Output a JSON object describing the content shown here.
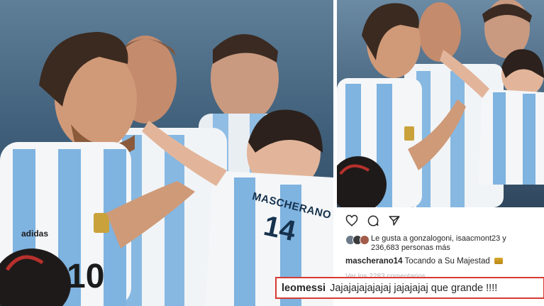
{
  "post": {
    "actions": {
      "like_icon": "heart-outline-icon",
      "comment_icon": "comment-bubble-icon",
      "share_icon": "paper-plane-icon"
    },
    "likes_line_1": "Le gusta a gonzalogoni, isaacmont23 y",
    "likes_line_2": "236,683 personas más",
    "caption_user": "mascherano14",
    "caption_text": "Tocando a Su Majestad",
    "view_comments": "Ver los 2283 comentarios"
  },
  "highlight_comment": {
    "user": "leomessi",
    "text": "Jajajajajajajaj jajajajaj que grande !!!!"
  },
  "jerseys": {
    "number_left": "10",
    "baby_name": "MASCHERANO",
    "baby_number": "14",
    "brand": "adidas"
  },
  "colors": {
    "jersey_sky_blue": "#7fb3e0",
    "jersey_white": "#f4f6f8",
    "accent_red": "#d63b33",
    "text_dark": "#262626",
    "text_muted": "#b5b5b5"
  }
}
